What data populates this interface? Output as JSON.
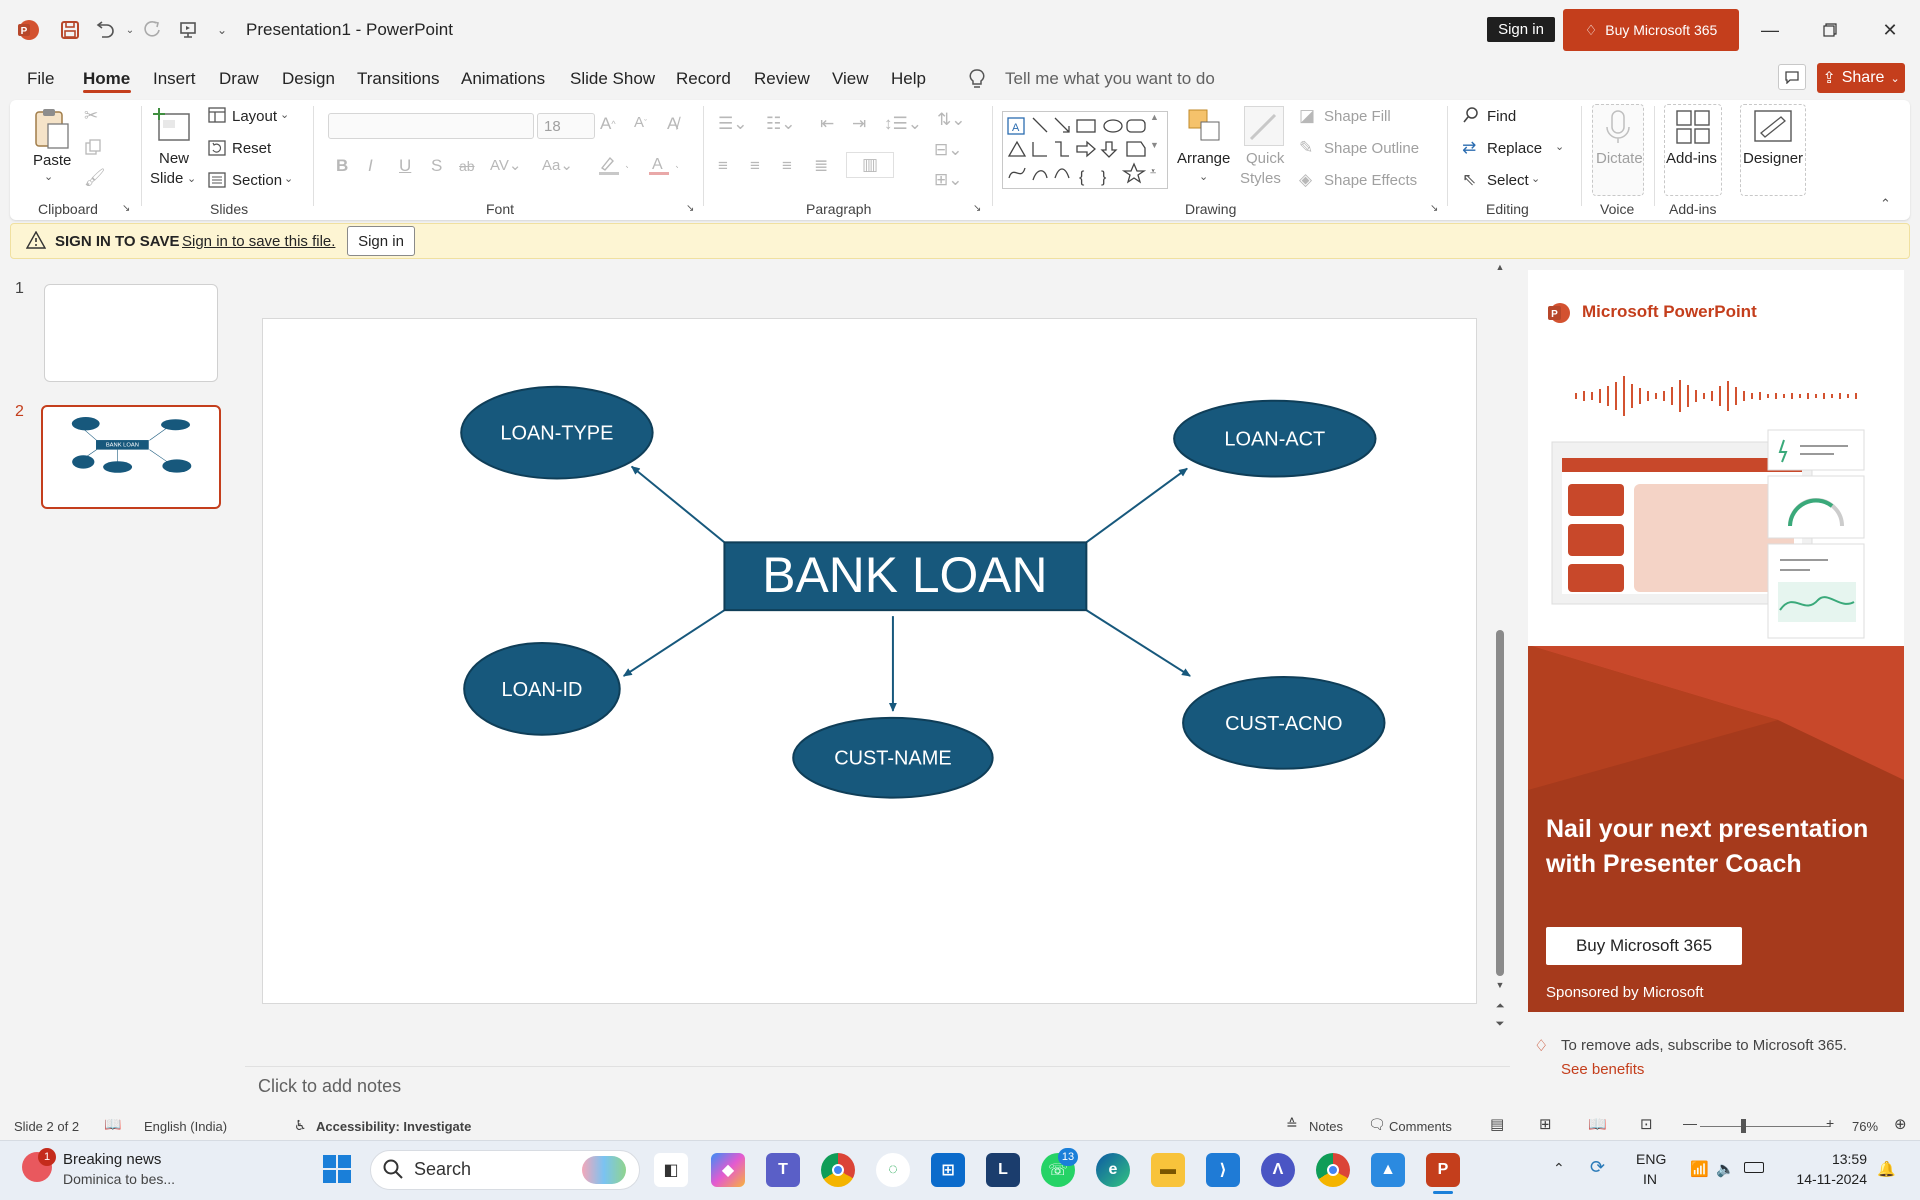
{
  "titlebar": {
    "doc_title": "Presentation1  -  PowerPoint",
    "sign_in": "Sign in",
    "buy": "Buy Microsoft 365",
    "icons": [
      "powerpoint-logo-icon",
      "save-icon",
      "undo-icon",
      "redo-icon",
      "present-icon",
      "customize-qat-icon"
    ]
  },
  "menu": {
    "tabs": [
      "File",
      "Home",
      "Insert",
      "Draw",
      "Design",
      "Transitions",
      "Animations",
      "Slide Show",
      "Record",
      "Review",
      "View",
      "Help"
    ],
    "tell_me": "Tell me what you want to do",
    "share": "Share"
  },
  "ribbon": {
    "clipboard": {
      "label": "Clipboard",
      "paste": "Paste"
    },
    "slides": {
      "label": "Slides",
      "new_slide": "New",
      "new_slide2": "Slide",
      "layout": "Layout",
      "reset": "Reset",
      "section": "Section"
    },
    "font": {
      "label": "Font",
      "font_size": "18"
    },
    "paragraph": {
      "label": "Paragraph"
    },
    "drawing": {
      "label": "Drawing",
      "arrange": "Arrange",
      "quick_styles": "Quick",
      "quick_styles2": "Styles",
      "shape_fill": "Shape Fill",
      "shape_outline": "Shape Outline",
      "shape_effects": "Shape Effects"
    },
    "editing": {
      "label": "Editing",
      "find": "Find",
      "replace": "Replace",
      "select": "Select"
    },
    "voice": {
      "label": "Voice",
      "dictate": "Dictate"
    },
    "addins": {
      "label": "Add-ins",
      "addins_btn": "Add-ins",
      "designer": "Designer"
    }
  },
  "message_bar": {
    "title": "SIGN IN TO SAVE",
    "link": "Sign in to save this file.",
    "button": "Sign in"
  },
  "thumbnails": {
    "n1": "1",
    "n2": "2"
  },
  "slide": {
    "center": "BANK LOAN",
    "nodes": {
      "loan_type": "LOAN-TYPE",
      "loan_act": "LOAN-ACT",
      "loan_id": "LOAN-ID",
      "cust_name": "CUST-NAME",
      "cust_acno": "CUST-ACNO"
    },
    "shape_color": "#17587c"
  },
  "notes": {
    "placeholder": "Click to add notes"
  },
  "ad": {
    "brand": "Microsoft PowerPoint",
    "headline": "Nail your next presentation with Presenter Coach",
    "button": "Buy Microsoft 365",
    "sponsor": "Sponsored by Microsoft",
    "remove": "To remove ads, subscribe to Microsoft 365.",
    "benefits": "See benefits"
  },
  "status": {
    "slide": "Slide 2 of 2",
    "language": "English (India)",
    "accessibility": "Accessibility: Investigate",
    "notes": "Notes",
    "comments": "Comments",
    "zoom": "76%"
  },
  "taskbar": {
    "news_title": "Breaking news",
    "news_sub": "Dominica to bes...",
    "news_badge": "1",
    "search": "Search",
    "whatsapp_badge": "13",
    "lang1": "ENG",
    "lang2": "IN",
    "time": "13:59",
    "date": "14-11-2024"
  }
}
